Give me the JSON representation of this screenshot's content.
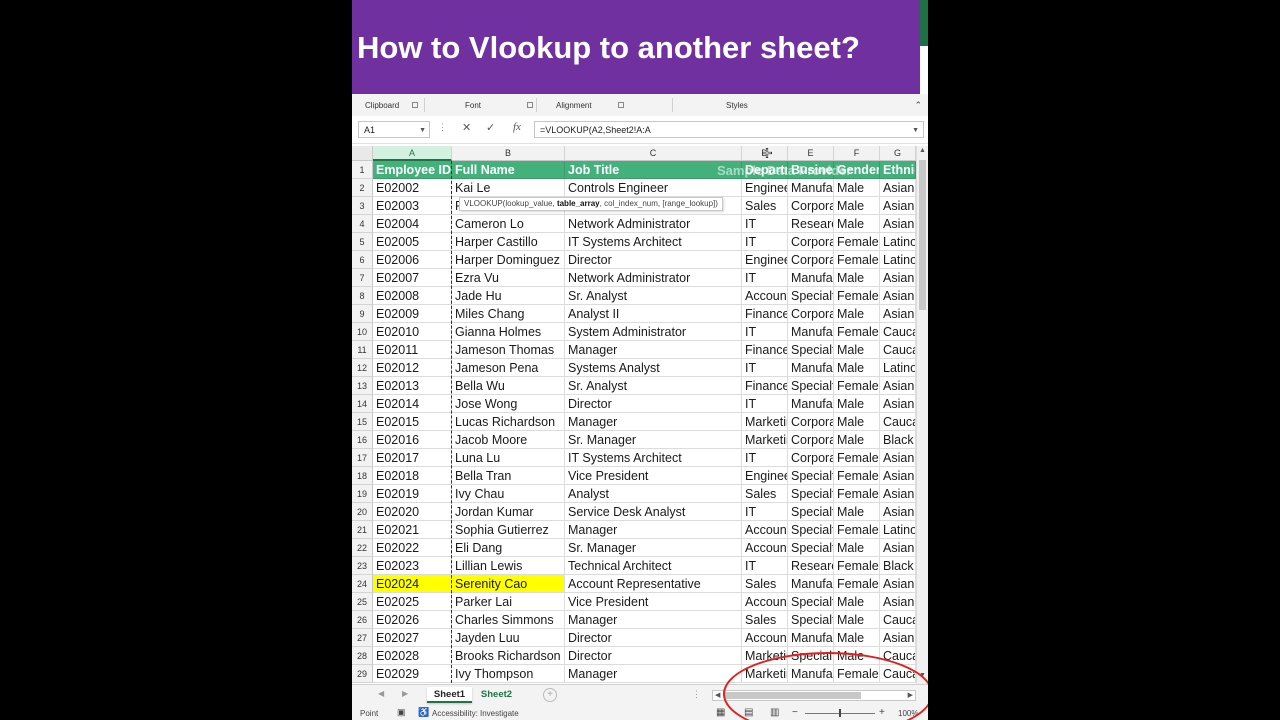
{
  "banner": {
    "title": "How to Vlookup to another sheet?"
  },
  "ribbon": {
    "groups": [
      "Clipboard",
      "Font",
      "Alignment",
      "Styles"
    ]
  },
  "formula_bar": {
    "name_box": "A1",
    "formula": "=VLOOKUP(A2,Sheet2!A:A"
  },
  "columns": [
    "A",
    "B",
    "C",
    "D",
    "E",
    "F",
    "G"
  ],
  "header_row": [
    "Employee ID",
    "Full Name",
    "Job Title",
    "Department",
    "Business Unit",
    "Gender",
    "Ethnicity"
  ],
  "watermark": "Sample Data Provider",
  "tooltip": {
    "pre": "VLOOKUP(lookup_value, ",
    "bold": "table_array",
    "post": ", col_index_num, [range_lookup])"
  },
  "rows": [
    [
      "E02002",
      "Kai Le",
      "Controls Engineer",
      "Engineering",
      "Manufacturing",
      "Male",
      "Asian"
    ],
    [
      "E02003",
      "R",
      "",
      "Sales",
      "Corporate",
      "Male",
      "Asian"
    ],
    [
      "E02004",
      "Cameron Lo",
      "Network Administrator",
      "IT",
      "Research",
      "Male",
      "Asian"
    ],
    [
      "E02005",
      "Harper Castillo",
      "IT Systems Architect",
      "IT",
      "Corporate",
      "Female",
      "Latino"
    ],
    [
      "E02006",
      "Harper Dominguez",
      "Director",
      "Engineering",
      "Corporate",
      "Female",
      "Latino"
    ],
    [
      "E02007",
      "Ezra Vu",
      "Network Administrator",
      "IT",
      "Manufacturing",
      "Male",
      "Asian"
    ],
    [
      "E02008",
      "Jade Hu",
      "Sr. Analyst",
      "Accounting",
      "Specialty",
      "Female",
      "Asian"
    ],
    [
      "E02009",
      "Miles Chang",
      "Analyst II",
      "Finance",
      "Corporate",
      "Male",
      "Asian"
    ],
    [
      "E02010",
      "Gianna Holmes",
      "System Administrator",
      "IT",
      "Manufacturing",
      "Female",
      "Caucasian"
    ],
    [
      "E02011",
      "Jameson Thomas",
      "Manager",
      "Finance",
      "Specialty",
      "Male",
      "Caucasian"
    ],
    [
      "E02012",
      "Jameson Pena",
      "Systems Analyst",
      "IT",
      "Manufacturing",
      "Male",
      "Latino"
    ],
    [
      "E02013",
      "Bella Wu",
      "Sr. Analyst",
      "Finance",
      "Specialty",
      "Female",
      "Asian"
    ],
    [
      "E02014",
      "Jose Wong",
      "Director",
      "IT",
      "Manufacturing",
      "Male",
      "Asian"
    ],
    [
      "E02015",
      "Lucas Richardson",
      "Manager",
      "Marketing",
      "Corporate",
      "Male",
      "Caucasian"
    ],
    [
      "E02016",
      "Jacob Moore",
      "Sr. Manager",
      "Marketing",
      "Corporate",
      "Male",
      "Black"
    ],
    [
      "E02017",
      "Luna Lu",
      "IT Systems Architect",
      "IT",
      "Corporate",
      "Female",
      "Asian"
    ],
    [
      "E02018",
      "Bella Tran",
      "Vice President",
      "Engineering",
      "Specialty",
      "Female",
      "Asian"
    ],
    [
      "E02019",
      "Ivy Chau",
      "Analyst",
      "Sales",
      "Specialty",
      "Female",
      "Asian"
    ],
    [
      "E02020",
      "Jordan Kumar",
      "Service Desk Analyst",
      "IT",
      "Specialty",
      "Male",
      "Asian"
    ],
    [
      "E02021",
      "Sophia Gutierrez",
      "Manager",
      "Accounting",
      "Specialty",
      "Female",
      "Latino"
    ],
    [
      "E02022",
      "Eli Dang",
      "Sr. Manager",
      "Accounting",
      "Specialty",
      "Male",
      "Asian"
    ],
    [
      "E02023",
      "Lillian Lewis",
      "Technical Architect",
      "IT",
      "Research",
      "Female",
      "Black"
    ],
    [
      "E02024",
      "Serenity Cao",
      "Account Representative",
      "Sales",
      "Manufacturing",
      "Female",
      "Asian"
    ],
    [
      "E02025",
      "Parker Lai",
      "Vice President",
      "Accounting",
      "Specialty",
      "Male",
      "Asian"
    ],
    [
      "E02026",
      "Charles Simmons",
      "Manager",
      "Sales",
      "Specialty",
      "Male",
      "Caucasian"
    ],
    [
      "E02027",
      "Jayden Luu",
      "Director",
      "Accounting",
      "Manufacturing",
      "Male",
      "Asian"
    ],
    [
      "E02028",
      "Brooks Richardson",
      "Director",
      "Marketing",
      "Specialty",
      "Male",
      "Caucasian"
    ],
    [
      "E02029",
      "Ivy Thompson",
      "Manager",
      "Marketing",
      "Manufacturing",
      "Female",
      "Caucasian"
    ]
  ],
  "highlight_row_number": 24,
  "sheet_tabs": [
    "Sheet1",
    "Sheet2"
  ],
  "status_bar": {
    "mode": "Point",
    "accessibility": "Accessibility: Investigate",
    "zoom": "100%"
  },
  "colors": {
    "banner": "#7030A0",
    "header_fill": "#44b07c",
    "excel_green": "#217346",
    "highlight": "#ffff00",
    "annotation_circle": "#e0201f"
  },
  "icons": [
    "cancel-icon",
    "enter-icon",
    "function-icon",
    "add-sheet-icon",
    "cell-cursor-icon",
    "accessibility-icon"
  ]
}
